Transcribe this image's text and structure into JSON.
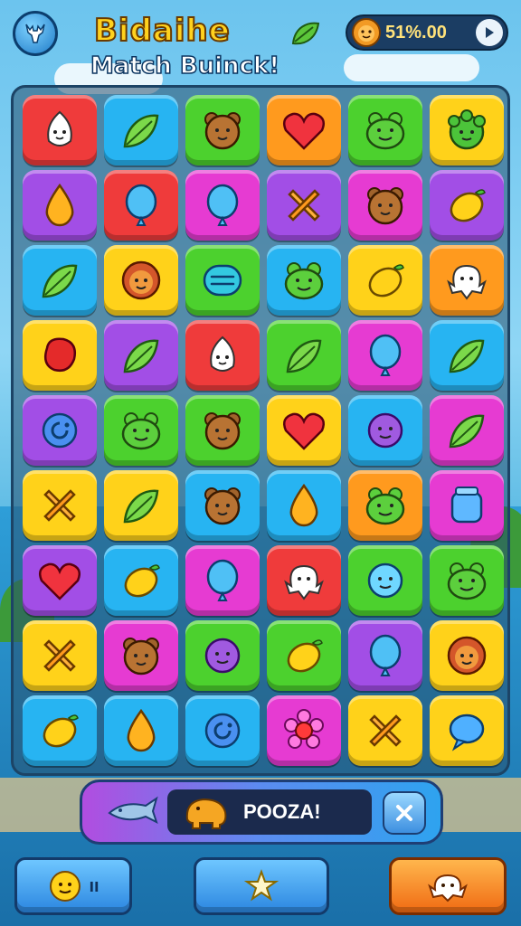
{
  "header": {
    "title": "Bidaihe",
    "subtitle": "Match Buinck!",
    "coins": "51%.00"
  },
  "colors": {
    "red": "#ef3b3b",
    "blue": "#27b4f2",
    "green": "#4cd12e",
    "orange": "#ff9a1e",
    "yellow": "#ffd21a",
    "purple": "#a24ee6",
    "pink": "#e63bd2"
  },
  "board": {
    "rows": [
      [
        {
          "color": "red",
          "icon": "onion-face-icon"
        },
        {
          "color": "blue",
          "icon": "leaf-icon"
        },
        {
          "color": "green",
          "icon": "bear-face-icon"
        },
        {
          "color": "orange",
          "icon": "heart-icon"
        },
        {
          "color": "green",
          "icon": "frog-face-icon"
        },
        {
          "color": "yellow",
          "icon": "bush-face-icon"
        }
      ],
      [
        {
          "color": "purple",
          "icon": "drop-icon"
        },
        {
          "color": "red",
          "icon": "balloon-icon"
        },
        {
          "color": "pink",
          "icon": "balloon-icon"
        },
        {
          "color": "purple",
          "icon": "cross-icon"
        },
        {
          "color": "pink",
          "icon": "bear-face-icon"
        },
        {
          "color": "purple",
          "icon": "lemon-icon"
        }
      ],
      [
        {
          "color": "blue",
          "icon": "leaf-icon"
        },
        {
          "color": "yellow",
          "icon": "lion-face-icon"
        },
        {
          "color": "green",
          "icon": "capsule-icon"
        },
        {
          "color": "blue",
          "icon": "frog-face-icon"
        },
        {
          "color": "yellow",
          "icon": "lemon-icon"
        },
        {
          "color": "orange",
          "icon": "ghost-icon"
        }
      ],
      [
        {
          "color": "yellow",
          "icon": "bean-icon"
        },
        {
          "color": "purple",
          "icon": "leaf-icon"
        },
        {
          "color": "red",
          "icon": "onion-face-icon"
        },
        {
          "color": "green",
          "icon": "leaf-icon"
        },
        {
          "color": "pink",
          "icon": "balloon-icon"
        },
        {
          "color": "blue",
          "icon": "leaf-icon"
        }
      ],
      [
        {
          "color": "purple",
          "icon": "swirl-icon"
        },
        {
          "color": "green",
          "icon": "frog-face-icon"
        },
        {
          "color": "green",
          "icon": "bear-face-icon"
        },
        {
          "color": "yellow",
          "icon": "heart-icon"
        },
        {
          "color": "blue",
          "icon": "circle-face-icon"
        },
        {
          "color": "pink",
          "icon": "leaf-icon"
        }
      ],
      [
        {
          "color": "yellow",
          "icon": "cross-icon"
        },
        {
          "color": "yellow",
          "icon": "leaf-icon"
        },
        {
          "color": "blue",
          "icon": "bear-face-icon"
        },
        {
          "color": "blue",
          "icon": "drop-icon"
        },
        {
          "color": "orange",
          "icon": "frog-face-icon"
        },
        {
          "color": "pink",
          "icon": "jar-icon"
        }
      ],
      [
        {
          "color": "purple",
          "icon": "heart-icon"
        },
        {
          "color": "blue",
          "icon": "lemon-icon"
        },
        {
          "color": "pink",
          "icon": "balloon-icon"
        },
        {
          "color": "red",
          "icon": "ghost-icon"
        },
        {
          "color": "green",
          "icon": "bubble-face-icon"
        },
        {
          "color": "green",
          "icon": "frog-face-icon"
        }
      ],
      [
        {
          "color": "yellow",
          "icon": "cross-icon"
        },
        {
          "color": "pink",
          "icon": "bear-face-icon"
        },
        {
          "color": "green",
          "icon": "circle-face-icon"
        },
        {
          "color": "green",
          "icon": "lemon-icon"
        },
        {
          "color": "purple",
          "icon": "balloon-icon"
        },
        {
          "color": "yellow",
          "icon": "lion-face-icon"
        }
      ],
      [
        {
          "color": "blue",
          "icon": "lemon-icon"
        },
        {
          "color": "blue",
          "icon": "drop-icon"
        },
        {
          "color": "blue",
          "icon": "swirl-icon"
        },
        {
          "color": "pink",
          "icon": "flower-icon"
        },
        {
          "color": "yellow",
          "icon": "cross-icon"
        },
        {
          "color": "yellow",
          "icon": "speech-bubble-icon"
        }
      ]
    ]
  },
  "combo": {
    "label": "POOZA!"
  },
  "buttons": {
    "left_label": "ıı"
  }
}
